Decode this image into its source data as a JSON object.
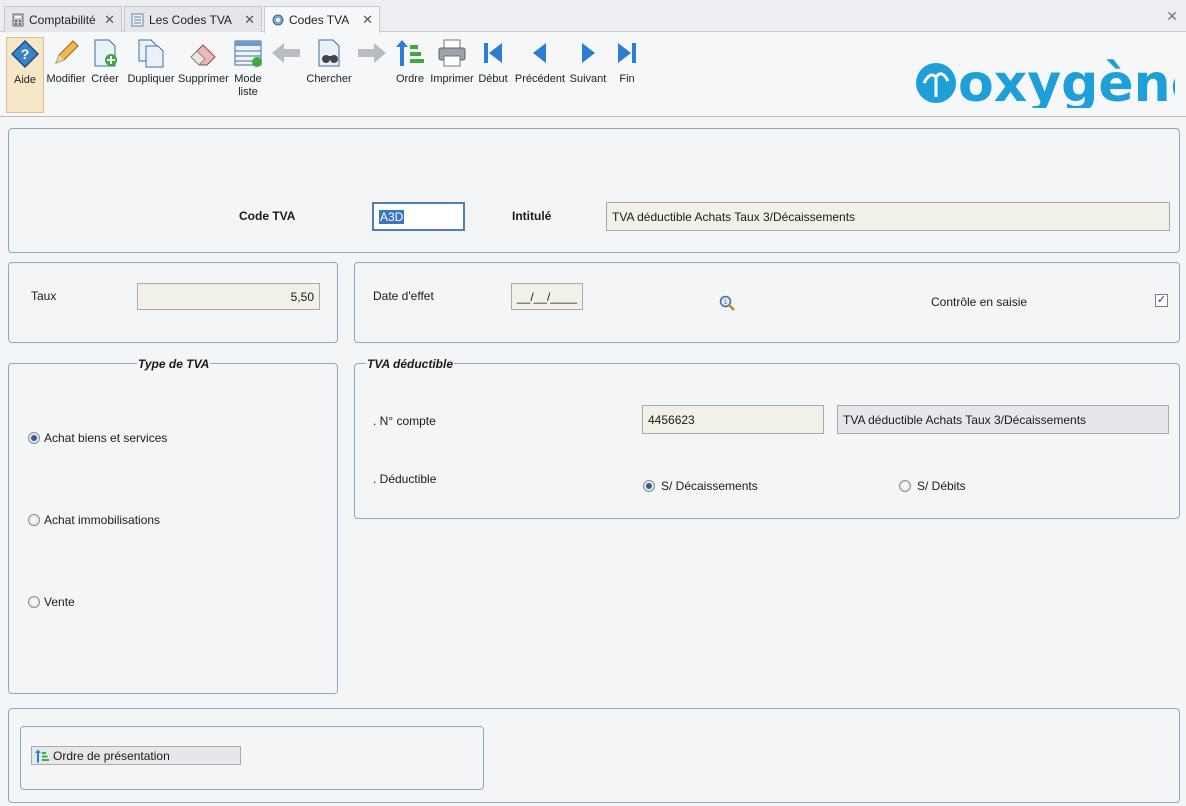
{
  "tabs": [
    {
      "label": "Comptabilité"
    },
    {
      "label": "Les Codes TVA"
    },
    {
      "label": "Codes TVA"
    }
  ],
  "toolbar": {
    "aide": "Aide",
    "modifier": "Modifier",
    "creer": "Créer",
    "dupliquer": "Dupliquer",
    "supprimer": "Supprimer",
    "mode_liste_1": "Mode",
    "mode_liste_2": "liste",
    "chercher": "Chercher",
    "ordre": "Ordre",
    "imprimer": "Imprimer",
    "debut": "Début",
    "precedent": "Précédent",
    "suivant": "Suivant",
    "fin": "Fin"
  },
  "logo_text": "oxygène",
  "header_panel": {
    "code_label": "Code TVA",
    "code_value": "A3D",
    "intitule_label": "Intitulé",
    "intitule_value": "TVA déductible Achats Taux 3/Décaissements"
  },
  "taux_panel": {
    "label": "Taux",
    "value": "5,50"
  },
  "date_panel": {
    "date_label": "Date d'effet",
    "date_value": "__/__/____",
    "controle_label": "Contrôle en saisie",
    "controle_checked": true
  },
  "type_tva": {
    "legend": "Type de TVA",
    "options": [
      "Achat biens et services",
      "Achat immobilisations",
      "Vente"
    ],
    "selected": "Achat biens et services"
  },
  "tva_deductible": {
    "legend": "TVA déductible",
    "compte_label": ". N° compte",
    "compte_value": "4456623",
    "compte_libelle": "TVA déductible Achats Taux 3/Décaissements",
    "deductible_label": ". Déductible",
    "options": [
      "S/ Décaissements",
      "S/ Débits"
    ],
    "selected": "S/ Décaissements"
  },
  "ordre_presentation": {
    "label": "Ordre de présentation"
  },
  "colors": {
    "panel_border": "#8ea7c4",
    "brand": "#1e9fd8",
    "toolbar_icon": "#2a7fd4"
  }
}
